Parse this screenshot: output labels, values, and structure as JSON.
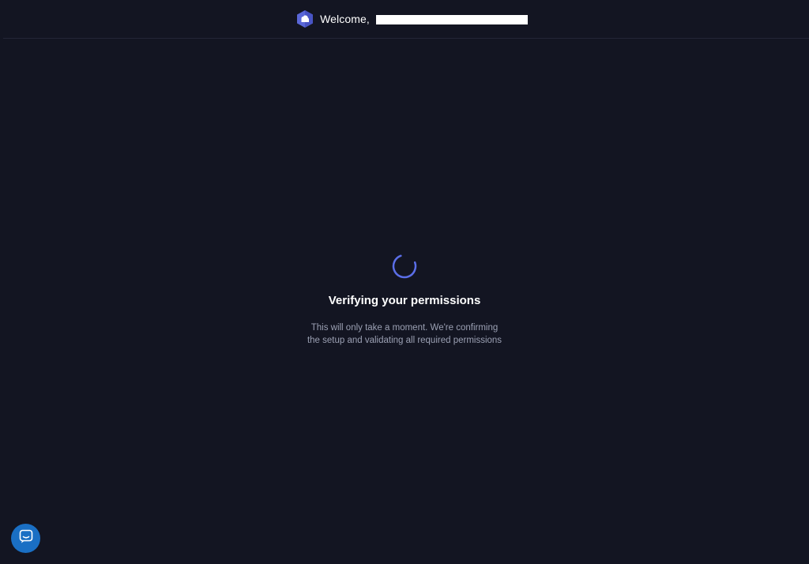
{
  "header": {
    "logo_icon": "hexagon-logo-icon",
    "welcome_text": "Welcome,",
    "user_name_redacted": true
  },
  "status": {
    "spinner_icon": "loading-spinner-icon",
    "title": "Verifying your permissions",
    "description_line1": "This will only take a moment. We're confirming",
    "description_line2": "the setup and validating all required permissions"
  },
  "support": {
    "chat_icon": "chat-bubble-icon"
  },
  "colors": {
    "background": "#131522",
    "accent": "#5b6ee8",
    "chat_button": "#1a6fc4",
    "muted_text": "#9ba0b3"
  }
}
